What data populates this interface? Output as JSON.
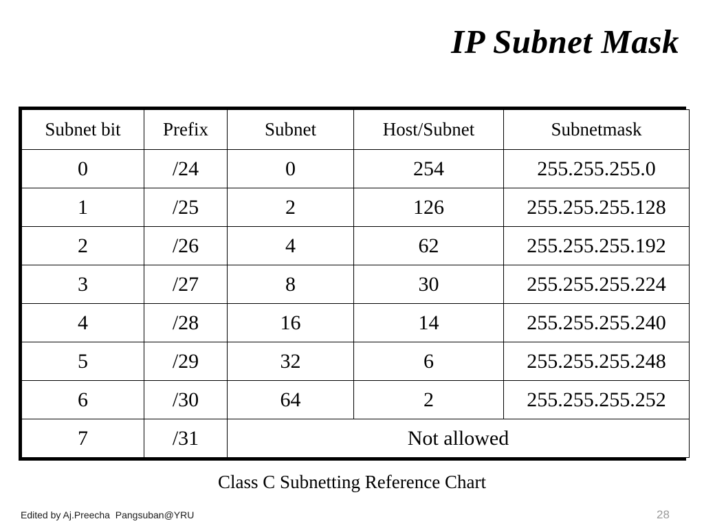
{
  "slide": {
    "title": "IP Subnet Mask",
    "caption": "Class C Subnetting Reference Chart",
    "page_number": "28",
    "credit": "Edited by Aj.Preecha  Pangsuban@YRU",
    "background_color": "#ffffff",
    "text_color": "#000000",
    "page_number_color": "#9a9a9a"
  },
  "chart_data": {
    "type": "table",
    "title": "Class C Subnetting Reference Chart",
    "columns": [
      "Subnet bit",
      "Prefix",
      "Subnet",
      "Host/Subnet",
      "Subnetmask"
    ],
    "rows": [
      [
        "0",
        "/24",
        "0",
        "254",
        "255.255.255.0"
      ],
      [
        "1",
        "/25",
        "2",
        "126",
        "255.255.255.128"
      ],
      [
        "2",
        "/26",
        "4",
        "62",
        "255.255.255.192"
      ],
      [
        "3",
        "/27",
        "8",
        "30",
        "255.255.255.224"
      ],
      [
        "4",
        "/28",
        "16",
        "14",
        "255.255.255.240"
      ],
      [
        "5",
        "/29",
        "32",
        "6",
        "255.255.255.248"
      ],
      [
        "6",
        "/30",
        "64",
        "2",
        "255.255.255.252"
      ],
      [
        "7",
        "/31",
        "Not allowed"
      ]
    ],
    "last_row_merged_span": 3,
    "last_row_merged_text": "Not allowed"
  },
  "table": {
    "headers": {
      "subnet_bit": "Subnet bit",
      "prefix": "Prefix",
      "subnet": "Subnet",
      "host_subnet": "Host/Subnet",
      "subnetmask": "Subnetmask"
    },
    "rows": [
      {
        "bit": "0",
        "prefix": "/24",
        "subnet": "0",
        "hosts": "254",
        "mask": "255.255.255.0"
      },
      {
        "bit": "1",
        "prefix": "/25",
        "subnet": "2",
        "hosts": "126",
        "mask": "255.255.255.128"
      },
      {
        "bit": "2",
        "prefix": "/26",
        "subnet": "4",
        "hosts": "62",
        "mask": "255.255.255.192"
      },
      {
        "bit": "3",
        "prefix": "/27",
        "subnet": "8",
        "hosts": "30",
        "mask": "255.255.255.224"
      },
      {
        "bit": "4",
        "prefix": "/28",
        "subnet": "16",
        "hosts": "14",
        "mask": "255.255.255.240"
      },
      {
        "bit": "5",
        "prefix": "/29",
        "subnet": "32",
        "hosts": "6",
        "mask": "255.255.255.248"
      },
      {
        "bit": "6",
        "prefix": "/30",
        "subnet": "64",
        "hosts": "2",
        "mask": "255.255.255.252"
      }
    ],
    "final_row": {
      "bit": "7",
      "prefix": "/31",
      "note": "Not allowed"
    }
  }
}
